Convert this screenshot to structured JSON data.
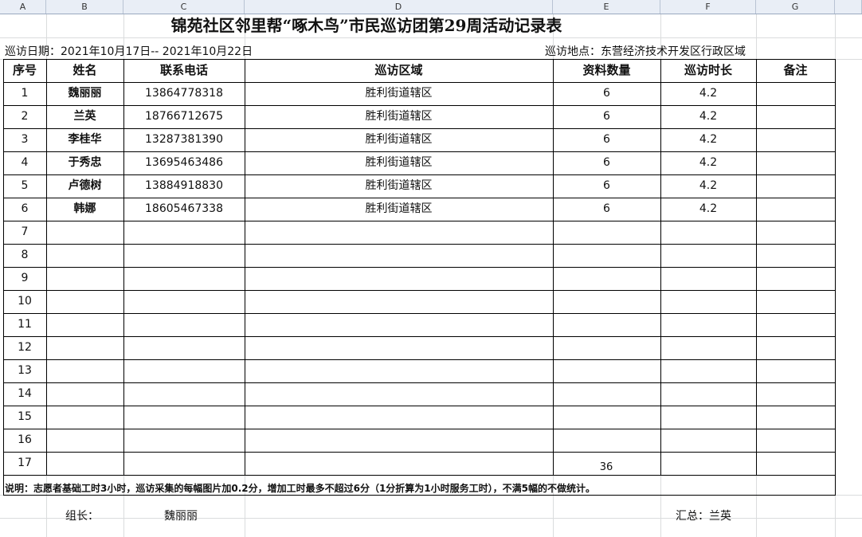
{
  "sheet": {
    "column_headers": [
      "A",
      "B",
      "C",
      "D",
      "E",
      "F",
      "G",
      ""
    ]
  },
  "title": "锦苑社区邻里帮“啄木鸟”市民巡访团第29周活动记录表",
  "meta": {
    "date": "巡访日期：2021年10月17日-- 2021年10月22日",
    "location": "巡访地点：东营经济技术开发区行政区域"
  },
  "table": {
    "headers": [
      "序号",
      "姓名",
      "联系电话",
      "巡访区域",
      "资料数量",
      "巡访时长",
      "备注"
    ],
    "rows": [
      {
        "no": "1",
        "name": "魏丽丽",
        "phone": "13864778318",
        "area": "胜利街道辖区",
        "count": "6",
        "hours": "4.2",
        "remark": ""
      },
      {
        "no": "2",
        "name": "兰英",
        "phone": "18766712675",
        "area": "胜利街道辖区",
        "count": "6",
        "hours": "4.2",
        "remark": ""
      },
      {
        "no": "3",
        "name": "李桂华",
        "phone": "13287381390",
        "area": "胜利街道辖区",
        "count": "6",
        "hours": "4.2",
        "remark": ""
      },
      {
        "no": "4",
        "name": "于秀忠",
        "phone": "13695463486",
        "area": "胜利街道辖区",
        "count": "6",
        "hours": "4.2",
        "remark": ""
      },
      {
        "no": "5",
        "name": "卢德树",
        "phone": "13884918830",
        "area": "胜利街道辖区",
        "count": "6",
        "hours": "4.2",
        "remark": ""
      },
      {
        "no": "6",
        "name": "韩娜",
        "phone": "18605467338",
        "area": "胜利街道辖区",
        "count": "6",
        "hours": "4.2",
        "remark": ""
      },
      {
        "no": "7",
        "name": "",
        "phone": "",
        "area": "",
        "count": "",
        "hours": "",
        "remark": ""
      },
      {
        "no": "8",
        "name": "",
        "phone": "",
        "area": "",
        "count": "",
        "hours": "",
        "remark": ""
      },
      {
        "no": "9",
        "name": "",
        "phone": "",
        "area": "",
        "count": "",
        "hours": "",
        "remark": ""
      },
      {
        "no": "10",
        "name": "",
        "phone": "",
        "area": "",
        "count": "",
        "hours": "",
        "remark": ""
      },
      {
        "no": "11",
        "name": "",
        "phone": "",
        "area": "",
        "count": "",
        "hours": "",
        "remark": ""
      },
      {
        "no": "12",
        "name": "",
        "phone": "",
        "area": "",
        "count": "",
        "hours": "",
        "remark": ""
      },
      {
        "no": "13",
        "name": "",
        "phone": "",
        "area": "",
        "count": "",
        "hours": "",
        "remark": ""
      },
      {
        "no": "14",
        "name": "",
        "phone": "",
        "area": "",
        "count": "",
        "hours": "",
        "remark": ""
      },
      {
        "no": "15",
        "name": "",
        "phone": "",
        "area": "",
        "count": "",
        "hours": "",
        "remark": ""
      },
      {
        "no": "16",
        "name": "",
        "phone": "",
        "area": "",
        "count": "",
        "hours": "",
        "remark": ""
      },
      {
        "no": "17",
        "name": "",
        "phone": "",
        "area": "",
        "count": "",
        "hours": "",
        "remark": ""
      }
    ],
    "total_count": "36"
  },
  "note": "说明：志愿者基础工时3小时，巡访采集的每幅图片加0.2分，增加工时最多不超过6分（1分折算为1小时服务工时），不满5幅的不做统计。",
  "footer": {
    "leader_label": "组长：",
    "leader_name": "魏丽丽",
    "summary": "汇总：兰英"
  }
}
